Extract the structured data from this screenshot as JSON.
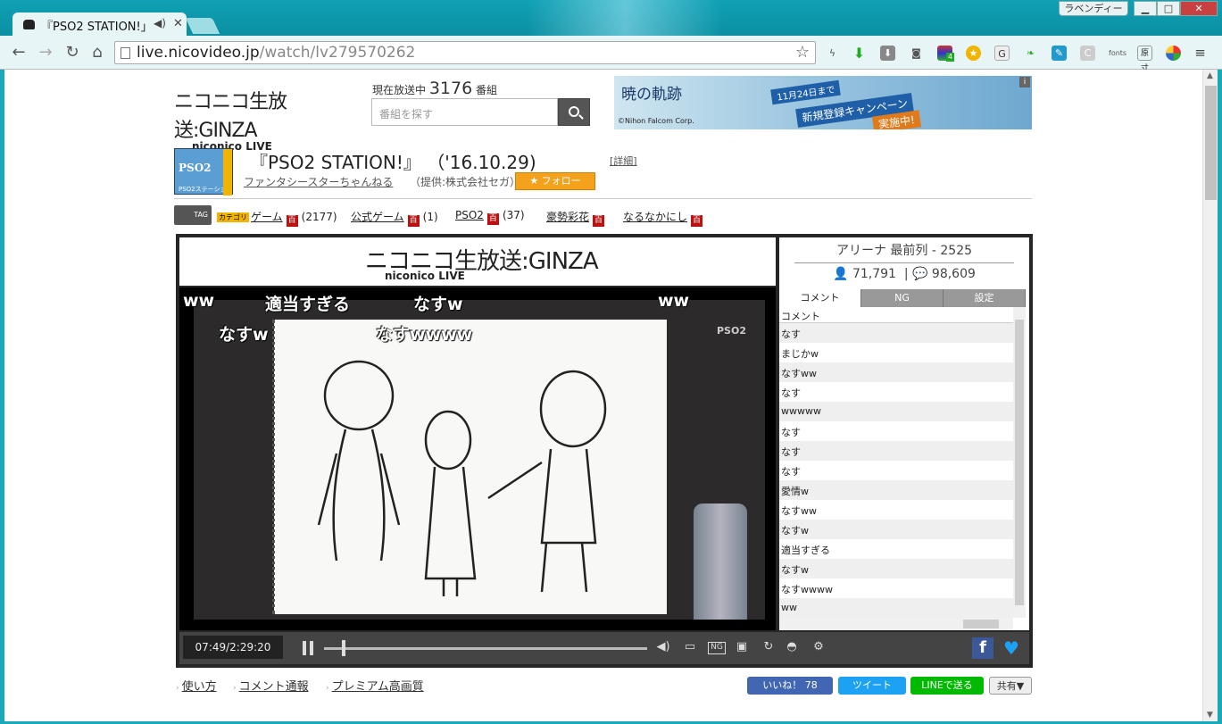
{
  "browser": {
    "tab_title": "『PSO2 STATION!」",
    "profile_label": "ラベンディー",
    "url_host": "live.nicovideo.jp",
    "url_path": "/watch/lv279570262",
    "extensions": [
      "bolt-icon",
      "download-green-icon",
      "download-gray-icon",
      "camera-icon",
      "stack-icon",
      "coin-icon",
      "g-icon",
      "leaf-icon",
      "pen-icon",
      "c-icon",
      "fonts-icon",
      "kanji-icon",
      "globe-icon",
      "menu-icon"
    ],
    "ext_badge": "4",
    "ext_fonts_label": "fonts",
    "ext_kanji_label": "原寸"
  },
  "header": {
    "logo_main": "ニコニコ生放送",
    "logo_sub": ":GINZA",
    "logo_en": "niconico LIVE",
    "live_prefix": "現在放送中",
    "live_count": "3176",
    "live_suffix": "番組",
    "search_placeholder": "番組を探す",
    "ad": {
      "title": "暁の軌跡",
      "company": "©Nihon Falcom Corp.",
      "promo1": "11月24日まで",
      "promo2": "新規登録キャンペーン",
      "promo3": "実施中!",
      "info": "i"
    }
  },
  "program": {
    "thumb_top": "PSO2",
    "thumb_bottom": "PSO2ステーション!",
    "title": "『PSO2 STATION!』 （'16.10.29)",
    "detail_link": "[詳細]",
    "channel": "ファンタシースターちゃんねる",
    "provider": "（提供:株式会社セガ）",
    "follow": "★ フォロー"
  },
  "tags": {
    "icon_label": "TAG",
    "category_badge": "カテゴリ",
    "dic_label": "百",
    "items": [
      {
        "name": "ゲーム",
        "count": "(2177)"
      },
      {
        "name": "公式ゲーム",
        "count": "(1)"
      },
      {
        "name": "PSO2",
        "count": "(37)"
      },
      {
        "name": "豪勢彩花",
        "count": ""
      },
      {
        "name": "なるなかにし",
        "count": ""
      }
    ]
  },
  "player": {
    "logo_main": "ニコニコ生放送",
    "logo_sub": ":GINZA",
    "logo_en": "niconico LIVE",
    "video_watermark": "PSO2",
    "overlay_comments": [
      "ww",
      "適当すぎる",
      "なすw",
      "ww",
      "なすw",
      "なすwwww"
    ],
    "time": "07:49/2:29:20",
    "seek_progress": 0.055,
    "room": "アリーナ 最前列 - 2525",
    "viewers": "71,791",
    "comments_count": "98,609",
    "side_tabs": [
      "コメント",
      "NG",
      "設定"
    ],
    "comment_header": "コメント",
    "comments": [
      "なす",
      "まじかw",
      "なすww",
      "なす",
      "wwwww",
      "なす",
      "なす",
      "なす",
      "愛情w",
      "なすww",
      "なすw",
      "適当すぎる",
      "なすw",
      "なすwwww",
      "ww"
    ]
  },
  "footer": {
    "links": [
      "使い方",
      "コメント通報",
      "プレミアム高画質"
    ],
    "like": "いいね！ 78",
    "tweet": "ツイート",
    "line": "LINEで送る",
    "share": "共有▼"
  }
}
